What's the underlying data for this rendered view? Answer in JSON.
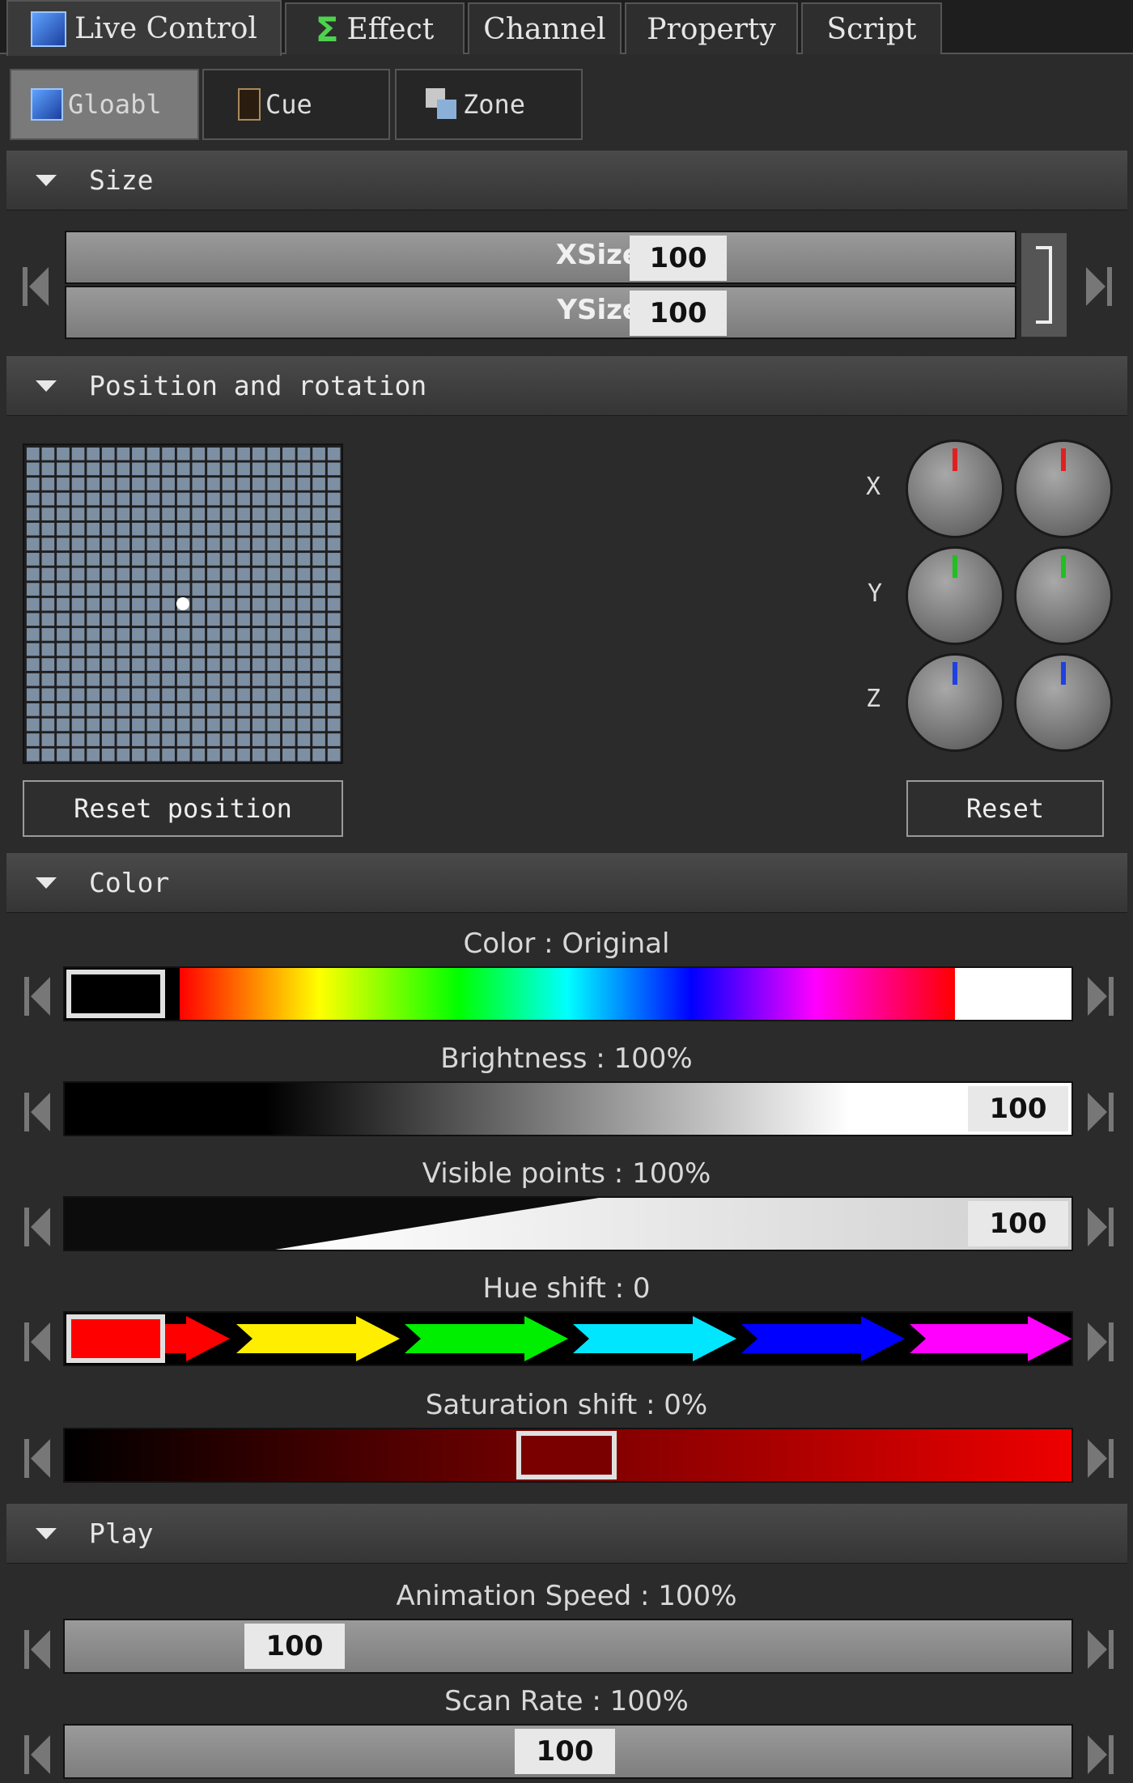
{
  "tabs": [
    {
      "label": "Live Control",
      "icon": "monitor-icon",
      "active": true
    },
    {
      "label": "Effect",
      "icon": "sigma-icon",
      "active": false
    },
    {
      "label": "Channel",
      "active": false
    },
    {
      "label": "Property",
      "active": false
    },
    {
      "label": "Script",
      "active": false
    }
  ],
  "subtabs": [
    {
      "label": "Gloabl",
      "icon": "monitor-icon",
      "active": true
    },
    {
      "label": "Cue",
      "icon": "cue-icon",
      "active": false
    },
    {
      "label": "Zone",
      "icon": "zone-icon",
      "active": false
    }
  ],
  "size": {
    "title": "Size",
    "xsize": {
      "label": "XSize",
      "value": "100"
    },
    "ysize": {
      "label": "YSize",
      "value": "100"
    }
  },
  "position": {
    "title": "Position and rotation",
    "reset_position_label": "Reset position",
    "reset_label": "Reset",
    "axes": [
      {
        "label": "X",
        "color": "#e02020"
      },
      {
        "label": "Y",
        "color": "#20c020"
      },
      {
        "label": "Z",
        "color": "#2040e0"
      }
    ]
  },
  "color": {
    "title": "Color",
    "color_label": "Color : Original",
    "brightness_label": "Brightness : 100%",
    "brightness_value": "100",
    "visible_label": "Visible points : 100%",
    "visible_value": "100",
    "hue_label": "Hue shift : 0",
    "saturation_label": "Saturation shift : 0%"
  },
  "play": {
    "title": "Play",
    "speed_label": "Animation Speed : 100%",
    "speed_value": "100",
    "scan_label": "Scan Rate : 100%",
    "scan_value": "100"
  }
}
